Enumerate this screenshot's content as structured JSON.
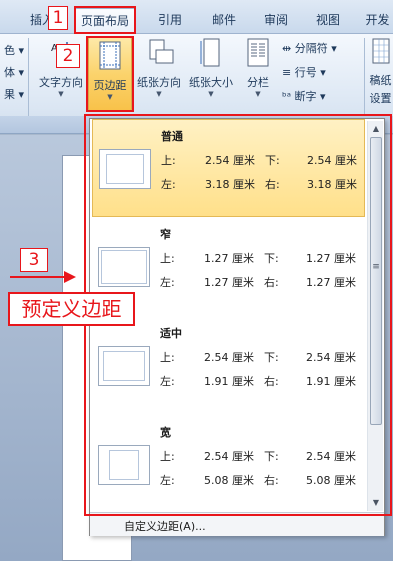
{
  "tabs": [
    {
      "label": "插入",
      "active": false
    },
    {
      "label": "页面布局",
      "active": true
    },
    {
      "label": "引用",
      "active": false
    },
    {
      "label": "邮件",
      "active": false
    },
    {
      "label": "审阅",
      "active": false
    },
    {
      "label": "视图",
      "active": false
    },
    {
      "label": "开发",
      "active": false
    }
  ],
  "ribbon": {
    "left_items": [
      "色",
      "体",
      "果"
    ],
    "buttons": {
      "text_direction": "文字方向",
      "margins": "页边距",
      "orientation": "纸张方向",
      "size": "纸张大小",
      "columns": "分栏"
    },
    "small_buttons": {
      "breaks": "分隔符",
      "line_numbers": "行号",
      "hyphenation": "断字"
    },
    "right_buttons": [
      "稿纸",
      "设置"
    ]
  },
  "gallery": {
    "presets": [
      {
        "name": "普通",
        "top": "2.54 厘米",
        "bottom": "2.54 厘米",
        "left": "3.18 厘米",
        "right": "3.18 厘米",
        "selected": true
      },
      {
        "name": "窄",
        "top": "1.27 厘米",
        "bottom": "1.27 厘米",
        "left": "1.27 厘米",
        "right": "1.27 厘米",
        "selected": false
      },
      {
        "name": "适中",
        "top": "2.54 厘米",
        "bottom": "2.54 厘米",
        "left": "1.91 厘米",
        "right": "1.91 厘米",
        "selected": false
      },
      {
        "name": "宽",
        "top": "2.54 厘米",
        "bottom": "2.54 厘米",
        "left": "5.08 厘米",
        "right": "5.08 厘米",
        "selected": false
      }
    ],
    "labels": {
      "top": "上:",
      "bottom": "下:",
      "left": "左:",
      "right": "右:"
    },
    "custom_margins": "自定义边距(A)..."
  },
  "annotations": {
    "step1": "1",
    "step2": "2",
    "step3": "3",
    "caption": "预定义边距"
  },
  "colors": {
    "annotation_red": "#e8161b",
    "selected_highlight": "#ffe08a"
  }
}
